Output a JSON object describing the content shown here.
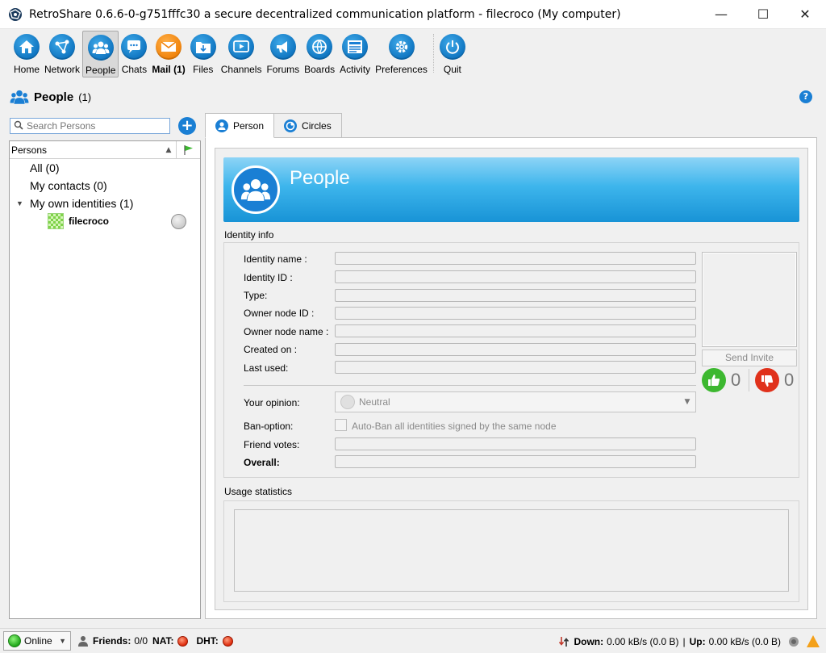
{
  "window": {
    "title": "RetroShare 0.6.6-0-g751fffc30 a secure decentralized communication platform - filecroco (My computer)",
    "minimize": "—",
    "maximize": "☐",
    "close": "✕"
  },
  "toolbar": {
    "items": [
      {
        "label": "Home",
        "icon": "home-icon"
      },
      {
        "label": "Network",
        "icon": "network-icon"
      },
      {
        "label": "People",
        "icon": "people-icon"
      },
      {
        "label": "Chats",
        "icon": "chat-icon"
      },
      {
        "label": "Mail (1)",
        "icon": "mail-icon"
      },
      {
        "label": "Files",
        "icon": "files-icon"
      },
      {
        "label": "Channels",
        "icon": "channels-icon"
      },
      {
        "label": "Forums",
        "icon": "forums-icon"
      },
      {
        "label": "Boards",
        "icon": "boards-icon"
      },
      {
        "label": "Activity",
        "icon": "activity-icon"
      },
      {
        "label": "Preferences",
        "icon": "gear-icon"
      },
      {
        "label": "Quit",
        "icon": "power-icon"
      }
    ]
  },
  "page": {
    "title": "People",
    "count": "(1)",
    "help": "?"
  },
  "left": {
    "search_placeholder": "Search Persons",
    "add": "+",
    "column_header": "Persons",
    "tree": {
      "all": "All (0)",
      "contacts": "My contacts (0)",
      "own": "My own identities (1)",
      "identity": "filecroco"
    }
  },
  "tabs": [
    {
      "label": "Person"
    },
    {
      "label": "Circles"
    }
  ],
  "banner": {
    "title": "People"
  },
  "identity_info": {
    "group_label": "Identity info",
    "fields": [
      {
        "label": "Identity name :",
        "value": ""
      },
      {
        "label": "Identity ID :",
        "value": ""
      },
      {
        "label": "Type:",
        "value": ""
      },
      {
        "label": "Owner node ID :",
        "value": ""
      },
      {
        "label": "Owner node name :",
        "value": ""
      },
      {
        "label": "Created on :",
        "value": ""
      },
      {
        "label": "Last used:",
        "value": ""
      }
    ],
    "send_invite": "Send Invite",
    "votes_up": "0",
    "votes_down": "0",
    "opinion_label": "Your opinion:",
    "opinion_value": "Neutral",
    "ban_label": "Ban-option:",
    "ban_checkbox": "Auto-Ban all identities signed by the same node",
    "friend_votes_label": "Friend votes:",
    "overall_label": "Overall:"
  },
  "usage": {
    "group_label": "Usage statistics"
  },
  "status": {
    "online": "Online",
    "friends_label": "Friends:",
    "friends_value": "0/0",
    "nat_label": "NAT:",
    "dht_label": "DHT:",
    "down_label": "Down:",
    "down_value": "0.00 kB/s (0.0 B)",
    "separator": "|",
    "up_label": "Up:",
    "up_value": "0.00 kB/s (0.0 B)"
  }
}
